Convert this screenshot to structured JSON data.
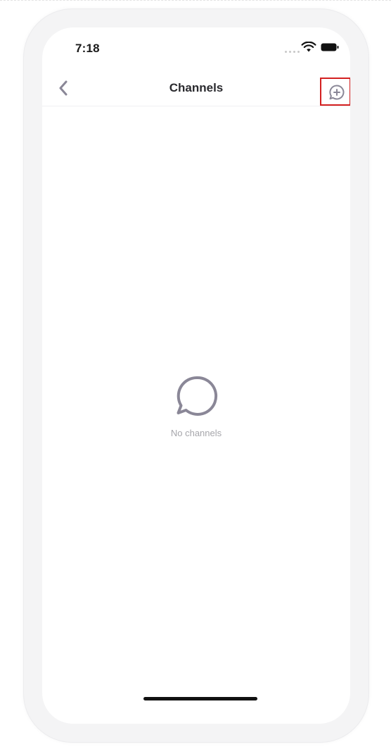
{
  "status_bar": {
    "time": "7:18"
  },
  "nav": {
    "title": "Channels",
    "back_icon": "chevron-left-icon",
    "action_icon": "new-message-plus-icon"
  },
  "empty_state": {
    "icon": "chat-bubble-icon",
    "text": "No channels"
  },
  "colors": {
    "accent_icon": "#8a8797",
    "highlight_border": "#d32020",
    "title_text": "#2a2a2e",
    "muted_text": "#a6a6ab"
  }
}
